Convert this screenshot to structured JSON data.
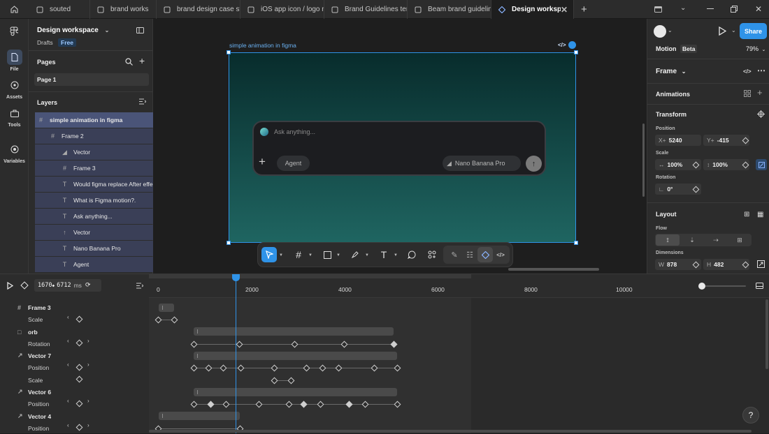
{
  "tabs": [
    {
      "label": "souted",
      "icon": "file-icon"
    },
    {
      "label": "brand works",
      "icon": "file-icon"
    },
    {
      "label": "brand design case stu",
      "icon": "file-icon"
    },
    {
      "label": "iOS app icon / logo mo",
      "icon": "file-icon"
    },
    {
      "label": "Brand Guidelines temp",
      "icon": "file-icon"
    },
    {
      "label": "Beam brand guideline",
      "icon": "file-icon"
    },
    {
      "label": "Design workspace",
      "icon": "diamond-icon",
      "active": true
    }
  ],
  "rail": [
    {
      "label": "File",
      "icon": "file-icon"
    },
    {
      "label": "Assets",
      "icon": "assets-icon"
    },
    {
      "label": "Tools",
      "icon": "tools-icon"
    },
    {
      "label": "Variables",
      "icon": "variables-icon"
    }
  ],
  "file": {
    "title": "Design workspace",
    "location": "Drafts",
    "plan": "Free"
  },
  "pages": {
    "title": "Pages",
    "items": [
      "Page 1"
    ]
  },
  "layers": {
    "title": "Layers",
    "items": [
      {
        "label": "simple animation in figma",
        "icon": "#",
        "depth": 0
      },
      {
        "label": "Frame 2",
        "icon": "#",
        "depth": 1
      },
      {
        "label": "Vector",
        "icon": "◢",
        "depth": 2
      },
      {
        "label": "Frame 3",
        "icon": "#",
        "depth": 2
      },
      {
        "label": "Would figma replace After effe",
        "icon": "T",
        "depth": 2
      },
      {
        "label": "What is Figma motion?.",
        "icon": "T",
        "depth": 2
      },
      {
        "label": "Ask anything...",
        "icon": "T",
        "depth": 2
      },
      {
        "label": "Vector",
        "icon": "↑",
        "depth": 2
      },
      {
        "label": "Nano Banana Pro",
        "icon": "T",
        "depth": 2
      },
      {
        "label": "Agent",
        "icon": "T",
        "depth": 2
      }
    ]
  },
  "canvas": {
    "frame_label": "simple animation in figma",
    "ask_placeholder": "Ask anything...",
    "agent_label": "Agent",
    "model_label": "Nano Banana Pro"
  },
  "right": {
    "share_label": "Share",
    "motion_label": "Motion",
    "motion_badge": "Beta",
    "zoom": "79%",
    "frame_label": "Frame",
    "animations_label": "Animations",
    "transform_label": "Transform",
    "position_label": "Position",
    "x_prefix": "X+",
    "x_value": "5240",
    "y_prefix": "Y+",
    "y_value": "-415",
    "scale_label": "Scale",
    "scale_x": "100%",
    "scale_y": "100%",
    "rotation_label": "Rotation",
    "rotation_value": "0°",
    "layout_label": "Layout",
    "flow_label": "Flow",
    "dimensions_label": "Dimensions",
    "w_prefix": "W",
    "w_value": "878",
    "h_prefix": "H",
    "h_value": "482"
  },
  "timeline": {
    "current_time": "1670",
    "duration": "6712",
    "unit": "ms",
    "ruler": [
      "0",
      "2000",
      "4000",
      "6000",
      "8000",
      "10000"
    ],
    "tracks": [
      {
        "label": "Frame 3",
        "kind": "layer",
        "icon": "#"
      },
      {
        "label": "Scale",
        "kind": "prop"
      },
      {
        "label": "orb",
        "kind": "layer",
        "icon": "□"
      },
      {
        "label": "Rotation",
        "kind": "prop"
      },
      {
        "label": "Vector 7",
        "kind": "layer",
        "icon": "↗"
      },
      {
        "label": "Position",
        "kind": "prop"
      },
      {
        "label": "Scale",
        "kind": "prop"
      },
      {
        "label": "Vector 6",
        "kind": "layer",
        "icon": "↗"
      },
      {
        "label": "Position",
        "kind": "prop"
      },
      {
        "label": "Vector 4",
        "kind": "layer",
        "icon": "↗"
      },
      {
        "label": "Position",
        "kind": "prop"
      }
    ]
  },
  "help_label": "?",
  "colors": {
    "accent": "#2f93e8",
    "frame_top": "#082c2c",
    "frame_bottom": "#1f6561",
    "panel": "#2c2c2c",
    "canvas": "#1e1e1e"
  }
}
